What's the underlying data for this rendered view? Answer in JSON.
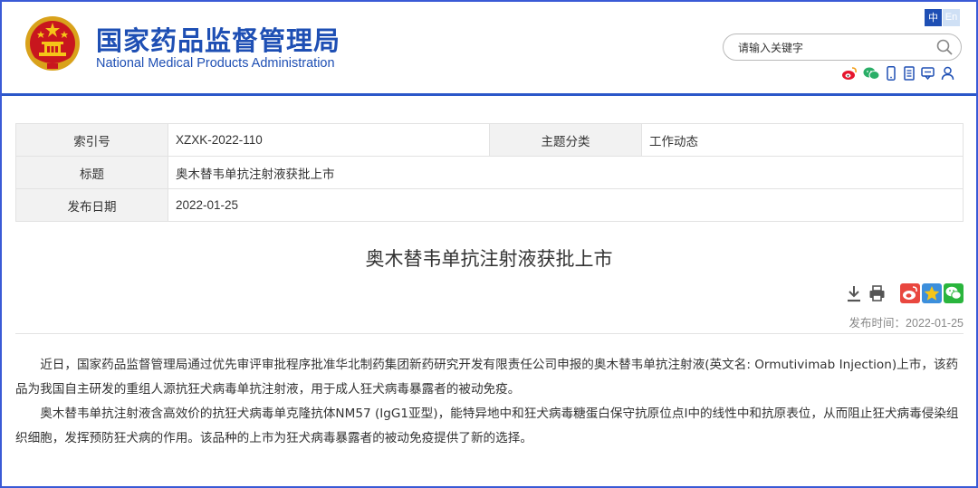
{
  "header": {
    "site_name_cn": "国家药品监督管理局",
    "site_name_en": "National Medical Products Administration",
    "lang_zh": "中",
    "lang_en": "En",
    "search_placeholder": "请输入关键字",
    "social_icons": [
      "weibo-icon",
      "wechat-icon",
      "mobile-icon",
      "app-icon",
      "message-icon",
      "user-icon"
    ]
  },
  "info": {
    "index_label": "索引号",
    "index_value": "XZXK-2022-110",
    "topic_label": "主题分类",
    "topic_value": "工作动态",
    "title_label": "标题",
    "title_value": "奥木替韦单抗注射液获批上市",
    "date_label": "发布日期",
    "date_value": "2022-01-25"
  },
  "article": {
    "title": "奥木替韦单抗注射液获批上市",
    "publish_label": "发布时间：",
    "publish_date": "2022-01-25",
    "paragraphs": [
      "近日，国家药品监督管理局通过优先审评审批程序批准华北制药集团新药研究开发有限责任公司申报的奥木替韦单抗注射液(英文名: Ormutivimab Injection)上市，该药品为我国自主研发的重组人源抗狂犬病毒单抗注射液，用于成人狂犬病毒暴露者的被动免疫。",
      "奥木替韦单抗注射液含高效价的抗狂犬病毒单克隆抗体NM57 (IgG1亚型)，能特异地中和狂犬病毒糖蛋白保守抗原位点I中的线性中和抗原表位，从而阻止狂犬病毒侵染组织细胞，发挥预防狂犬病的作用。该品种的上市为狂犬病毒暴露者的被动免疫提供了新的选择。"
    ]
  },
  "colors": {
    "brand": "#1e4fb4",
    "frame": "#3a5ad6",
    "label_bg": "#f2f2f2"
  }
}
